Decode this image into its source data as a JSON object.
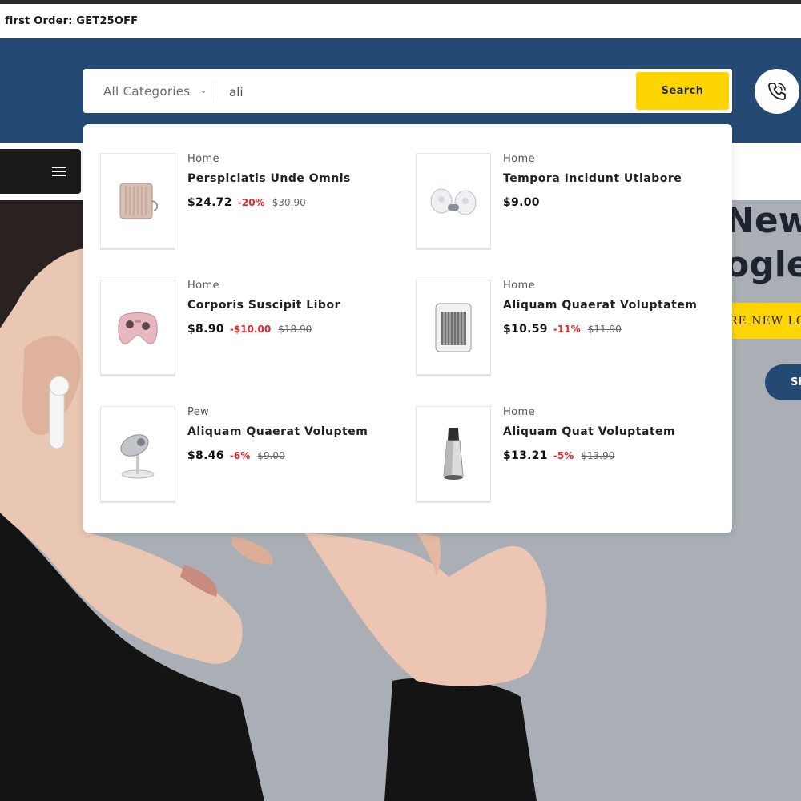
{
  "promo": {
    "text": "first Order: GET25OFF"
  },
  "search": {
    "category_label": "All Categories",
    "query": "ali",
    "button_label": "Search"
  },
  "hero": {
    "title_line1": "New",
    "title_line2": "ogle",
    "tag_text": "RE NEW LO",
    "button_text": "Sh"
  },
  "results": [
    {
      "category": "Home",
      "name": "Perspiciatis Unde Omnis",
      "price": "$24.72",
      "discount": "-20%",
      "old_price": "$30.90"
    },
    {
      "category": "Home",
      "name": "Tempora Incidunt Utlabore",
      "price": "$9.00",
      "discount": "",
      "old_price": ""
    },
    {
      "category": "Home",
      "name": "Corporis Suscipit Libor",
      "price": "$8.90",
      "discount": "-$10.00",
      "old_price": "$18.90"
    },
    {
      "category": "Home",
      "name": "Aliquam Quaerat Voluptatem",
      "price": "$10.59",
      "discount": "-11%",
      "old_price": "$11.90"
    },
    {
      "category": "Pew",
      "name": "Aliquam Quaerat Voluptem",
      "price": "$8.46",
      "discount": "-6%",
      "old_price": "$9.00"
    },
    {
      "category": "Home",
      "name": "Aliquam Quat Voluptatem",
      "price": "$13.21",
      "discount": "-5%",
      "old_price": "$13.90"
    }
  ],
  "colors": {
    "header": "#244a73",
    "accent": "#ffd500",
    "discount": "#e0262b"
  },
  "icons": [
    "phone-icon",
    "menu-icon",
    "chevron-down-icon"
  ]
}
